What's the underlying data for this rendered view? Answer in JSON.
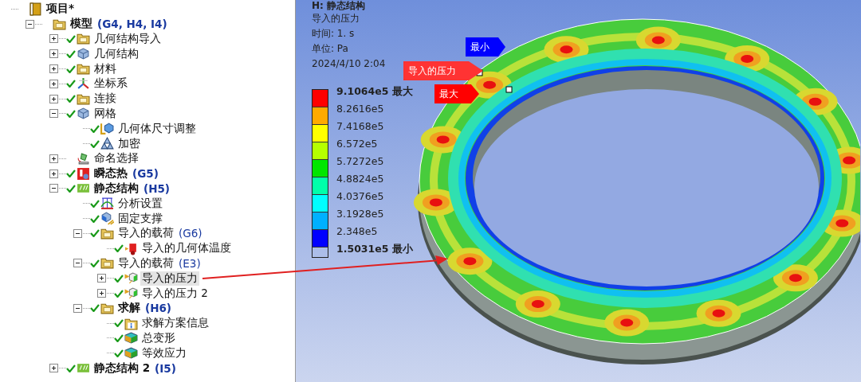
{
  "tree": [
    {
      "label": "项目*",
      "bold": true,
      "kind": "book",
      "selected": false,
      "children": [
        {
          "label": "模型",
          "tag": "(G4, H4, I4)",
          "bold": true,
          "kind": "folder",
          "expanded": true,
          "selected": false,
          "children": [
            {
              "label": "几何结构导入",
              "kind": "folder",
              "expanded": false,
              "check": true,
              "selected": false
            },
            {
              "label": "几何结构",
              "kind": "cube",
              "expanded": false,
              "check": true,
              "selected": false
            },
            {
              "label": "材料",
              "kind": "folder",
              "expanded": false,
              "check": true,
              "selected": false
            },
            {
              "label": "坐标系",
              "kind": "axes",
              "expanded": false,
              "check": true,
              "selected": false
            },
            {
              "label": "连接",
              "kind": "folder",
              "expanded": false,
              "check": true,
              "selected": false
            },
            {
              "label": "网格",
              "kind": "cube",
              "expanded": true,
              "check": true,
              "selected": false,
              "children": [
                {
                  "label": "几何体尺寸调整",
                  "kind": "sizing",
                  "check": true,
                  "selected": false
                },
                {
                  "label": "加密",
                  "kind": "refine",
                  "check": true,
                  "selected": false
                }
              ]
            },
            {
              "label": "命名选择",
              "kind": "named",
              "expanded": false,
              "selected": false
            },
            {
              "label": "瞬态热",
              "tag": "(G5)",
              "bold": true,
              "kind": "thermo",
              "expanded": false,
              "check": true,
              "selected": false
            },
            {
              "label": "静态结构",
              "tag": "(H5)",
              "bold": true,
              "kind": "static",
              "expanded": true,
              "check": true,
              "selected": false,
              "children": [
                {
                  "label": "分析设置",
                  "kind": "settings",
                  "check": true,
                  "selected": false
                },
                {
                  "label": "固定支撑",
                  "kind": "support",
                  "check": true,
                  "selected": false
                },
                {
                  "label": "导入的载荷",
                  "tag": "(G6)",
                  "kind": "folder",
                  "expanded": true,
                  "check": true,
                  "selected": false,
                  "children": [
                    {
                      "label": "导入的几何体温度",
                      "kind": "heat",
                      "check": true,
                      "selected": false
                    }
                  ]
                },
                {
                  "label": "导入的载荷",
                  "tag": "(E3)",
                  "kind": "folder",
                  "expanded": true,
                  "check": true,
                  "selected": false,
                  "children": [
                    {
                      "label": "导入的压力",
                      "kind": "pressure",
                      "expanded": false,
                      "check": true,
                      "selected": true
                    },
                    {
                      "label": "导入的压力 2",
                      "kind": "pressure",
                      "expanded": false,
                      "check": true,
                      "selected": false
                    }
                  ]
                },
                {
                  "label": "求解",
                  "tag": "(H6)",
                  "bold": true,
                  "kind": "folder",
                  "expanded": true,
                  "check": true,
                  "selected": false,
                  "children": [
                    {
                      "label": "求解方案信息",
                      "kind": "info",
                      "check": true,
                      "selected": false
                    },
                    {
                      "label": "总变形",
                      "kind": "result",
                      "check": true,
                      "selected": false
                    },
                    {
                      "label": "等效应力",
                      "kind": "result",
                      "check": true,
                      "selected": false
                    }
                  ]
                }
              ]
            },
            {
              "label": "静态结构 2",
              "tag": "(I5)",
              "bold": true,
              "kind": "static",
              "expanded": false,
              "check": true,
              "selected": false
            }
          ]
        }
      ]
    }
  ],
  "viewport": {
    "title": "H: 静态结构",
    "lines": [
      "导入的压力",
      "时间: 1. s",
      "单位: Pa",
      "2024/4/10 2:04"
    ]
  },
  "legend": {
    "ticks": [
      {
        "label": "9.1064e5 最大",
        "bold": true
      },
      {
        "label": "8.2616e5",
        "bold": false
      },
      {
        "label": "7.4168e5",
        "bold": false
      },
      {
        "label": "6.572e5",
        "bold": false
      },
      {
        "label": "5.7272e5",
        "bold": false
      },
      {
        "label": "4.8824e5",
        "bold": false
      },
      {
        "label": "4.0376e5",
        "bold": false
      },
      {
        "label": "3.1928e5",
        "bold": false
      },
      {
        "label": "2.348e5",
        "bold": false
      },
      {
        "label": "1.5031e5 最小",
        "bold": true
      }
    ],
    "bands": [
      {
        "color": "#ff0000"
      },
      {
        "color": "#ffaa00"
      },
      {
        "color": "#ffff00"
      },
      {
        "color": "#b5ff00"
      },
      {
        "color": "#00e600"
      },
      {
        "color": "#00ffaa"
      },
      {
        "color": "#00ffff"
      },
      {
        "color": "#00b0ff"
      },
      {
        "color": "#0000ff"
      }
    ]
  },
  "probes": [
    {
      "label": "最小",
      "color": "#0000ff"
    },
    {
      "label": "导入的压力",
      "color": "#ff3333"
    },
    {
      "label": "最大",
      "color": "#ff0000"
    }
  ]
}
